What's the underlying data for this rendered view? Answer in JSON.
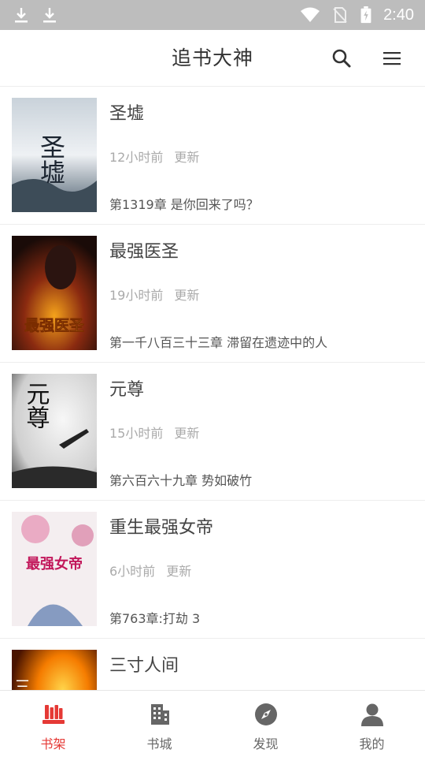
{
  "status_bar": {
    "time": "2:40",
    "icons": [
      "download-icon",
      "download-icon",
      "wifi-icon",
      "no-sim-icon",
      "battery-charging-icon"
    ]
  },
  "header": {
    "title": "追书大神",
    "icons": [
      "search-icon",
      "menu-icon"
    ]
  },
  "books": [
    {
      "title": "圣墟",
      "time_ago": "12小时前",
      "update_label": "更新",
      "latest_chapter": "第1319章 是你回来了吗？",
      "cover_text": "圣墟"
    },
    {
      "title": "最强医圣",
      "time_ago": "19小时前",
      "update_label": "更新",
      "latest_chapter": "第一千八百三十三章 滞留在遗迹中的人",
      "cover_text": "最强医圣"
    },
    {
      "title": "元尊",
      "time_ago": "15小时前",
      "update_label": "更新",
      "latest_chapter": "第六百六十九章 势如破竹",
      "cover_text": "元尊"
    },
    {
      "title": "重生最强女帝",
      "time_ago": "6小时前",
      "update_label": "更新",
      "latest_chapter": "第763章:打劫 3",
      "cover_text": "最强女帝"
    },
    {
      "title": "三寸人间",
      "time_ago": "",
      "update_label": "",
      "latest_chapter": "",
      "cover_text": "三寸"
    }
  ],
  "bottom_nav": [
    {
      "label": "书架",
      "icon": "bookshelf-icon",
      "active": true
    },
    {
      "label": "书城",
      "icon": "building-icon",
      "active": false
    },
    {
      "label": "发现",
      "icon": "compass-icon",
      "active": false
    },
    {
      "label": "我的",
      "icon": "person-icon",
      "active": false
    }
  ],
  "colors": {
    "accent": "#e53935",
    "status_bar": "#bdbdbd",
    "divider": "#eeeeee",
    "nav_inactive": "#666666"
  }
}
